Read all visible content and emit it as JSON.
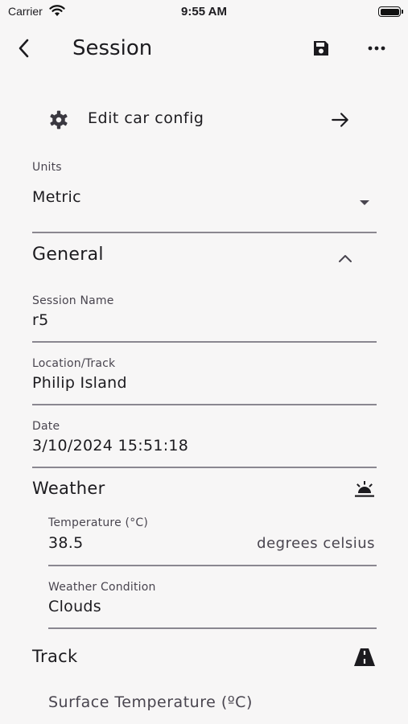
{
  "status_bar": {
    "carrier": "Carrier",
    "time": "9:55 AM",
    "battery_level": 1.0
  },
  "app_bar": {
    "title": "Session",
    "back_icon": "chevron-left-icon",
    "save_icon": "save-icon",
    "more_icon": "more-horizontal-icon"
  },
  "edit_config": {
    "label": "Edit car config",
    "icon": "gear-icon",
    "trailing_icon": "arrow-right-icon"
  },
  "units": {
    "label": "Units",
    "value": "Metric"
  },
  "general": {
    "title": "General",
    "session_name": {
      "label": "Session Name",
      "value": "r5"
    },
    "location": {
      "label": "Location/Track",
      "value": "Philip Island"
    },
    "date": {
      "label": "Date",
      "value": "3/10/2024 15:51:18"
    }
  },
  "weather": {
    "title": "Weather",
    "icon": "sunrise-icon",
    "temperature": {
      "label": "Temperature (°C)",
      "value": "38.5",
      "suffix": "degrees celsius"
    },
    "condition": {
      "label": "Weather Condition",
      "value": "Clouds"
    }
  },
  "track": {
    "title": "Track",
    "icon": "road-icon",
    "surface_temperature": {
      "label": "Surface Temperature (ºC)"
    }
  }
}
